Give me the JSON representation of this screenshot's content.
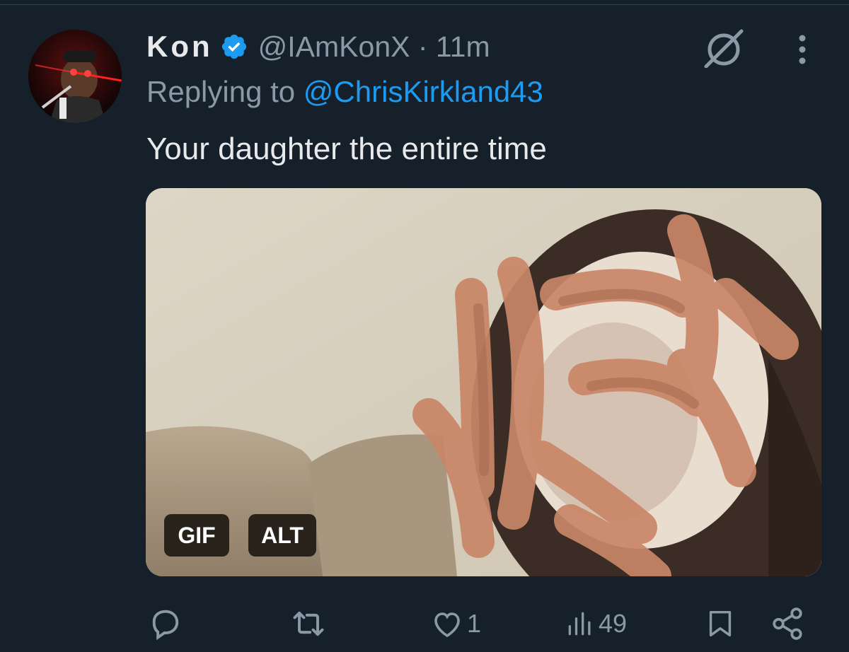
{
  "tweet": {
    "author_name": "Kon",
    "handle_time": "@IAmKonX · 11m",
    "replying_prefix": "Replying to ",
    "replying_to": "@ChrisKirkland43",
    "text": "Your daughter the entire time"
  },
  "media": {
    "gif_badge": "GIF",
    "alt_badge": "ALT"
  },
  "actions": {
    "likes": "1",
    "views": "49"
  },
  "icons": {
    "verified": "verified-badge-icon",
    "grok": "grok-icon",
    "more": "more-icon",
    "reply": "reply-icon",
    "retweet": "retweet-icon",
    "like": "like-icon",
    "views": "views-icon",
    "bookmark": "bookmark-icon",
    "share": "share-icon"
  },
  "colors": {
    "background": "#15202b",
    "link": "#1d9bf0",
    "muted": "#8b98a5",
    "text": "#e7e9ea"
  }
}
